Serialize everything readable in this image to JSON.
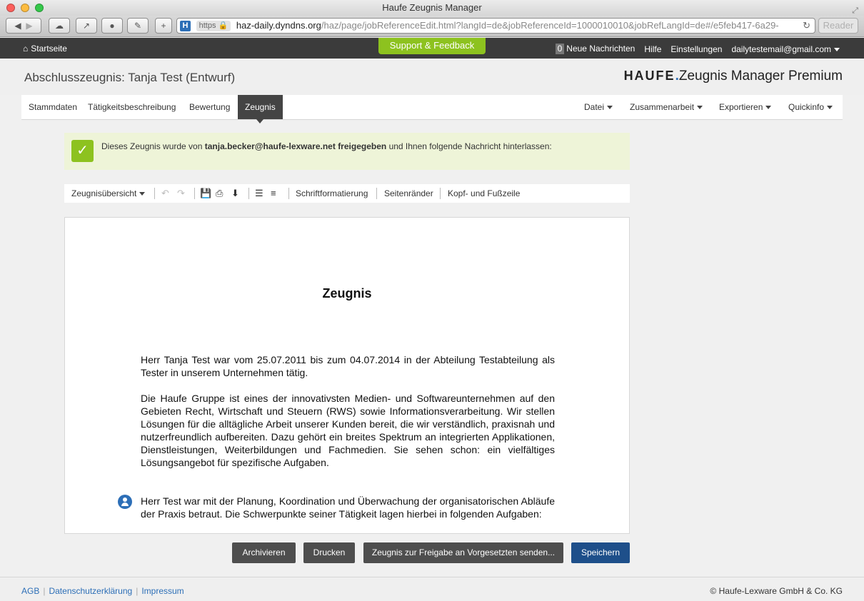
{
  "browser": {
    "window_title": "Haufe Zeugnis Manager",
    "url_scheme_badge": "https",
    "url_host": "haz-daily.dyndns.org",
    "url_path": "/haz/page/jobReferenceEdit.html?langId=de&jobReferenceId=1000010010&jobRefLangId=de#/e5feb417-6a29-",
    "reader_label": "Reader",
    "favicon_letter": "H"
  },
  "topnav": {
    "home_label": "Startseite",
    "support_label": "Support & Feedback",
    "message_count": "0",
    "messages_label": "Neue Nachrichten",
    "help_label": "Hilfe",
    "settings_label": "Einstellungen",
    "user_email": "dailytestemail@gmail.com"
  },
  "header": {
    "title": "Abschlusszeugnis: Tanja Test (Entwurf)",
    "brand_haufe": "HAUFE",
    "brand_dot": ".",
    "brand_product": "Zeugnis Manager Premium"
  },
  "tabs": {
    "left": [
      "Stammdaten",
      "Tätigkeitsbeschreibung",
      "Bewertung",
      "Zeugnis"
    ],
    "active": "Zeugnis",
    "right": [
      "Datei",
      "Zusammenarbeit",
      "Exportieren",
      "Quickinfo"
    ]
  },
  "notice": {
    "prefix": "Dieses Zeugnis wurde von",
    "email": "tanja.becker@haufe-lexware.net freigegeben",
    "suffix": "und Ihnen folgende Nachricht hinterlassen:"
  },
  "editor_toolbar": {
    "overview_label": "Zeugnisübersicht",
    "font_label": "Schriftformatierung",
    "margins_label": "Seitenränder",
    "header_footer_label": "Kopf- und Fußzeile"
  },
  "document": {
    "title": "Zeugnis",
    "paragraph_1": "Herr Tanja Test war vom 25.07.2011 bis zum 04.07.2014 in der Abteilung Testabteilung als Tester in unserem Unternehmen tätig.",
    "paragraph_2": "Die Haufe Gruppe ist eines der innovativsten Medien- und Softwareunternehmen auf den Gebieten Recht, Wirtschaft und Steuern (RWS) sowie Informationsverarbeitung. Wir stellen Lösungen für die alltägliche Arbeit unserer Kunden bereit, die wir verständlich, praxisnah und nutzerfreundlich aufbereiten. Dazu gehört ein breites Spektrum an integrierten Applikationen, Dienstleistungen, Weiterbildungen und Fachmedien. Sie sehen schon: ein vielfältiges Lösungsangebot für spezifische Aufgaben.",
    "paragraph_3": "Herr Test war mit der Planung, Koordination und Überwachung der organisatorischen Abläufe der Praxis betraut. Die Schwerpunkte seiner Tätigkeit lagen hierbei in folgenden Aufgaben:"
  },
  "actions": {
    "archive": "Archivieren",
    "print": "Drucken",
    "send": "Zeugnis zur Freigabe an Vorgesetzten senden...",
    "save": "Speichern"
  },
  "footer": {
    "links": [
      "AGB",
      "Datenschutzerklärung",
      "Impressum"
    ],
    "copyright": "© Haufe-Lexware GmbH & Co. KG"
  },
  "colors": {
    "topnav_bg": "#3b3b3b",
    "support_green": "#8dc21f",
    "primary_blue": "#1e4f8a",
    "link_blue": "#2d6fb7",
    "notice_bg": "#eef4d8"
  }
}
